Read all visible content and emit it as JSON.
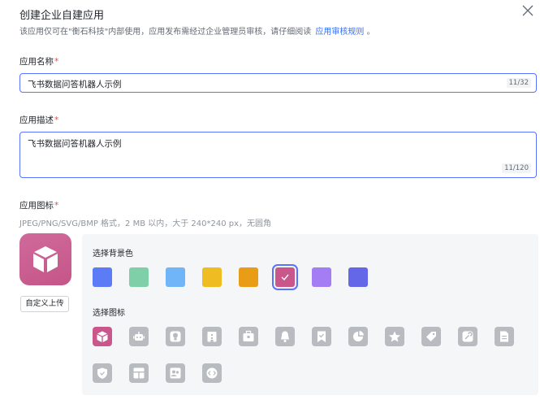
{
  "dialog": {
    "title": "创建企业自建应用",
    "subtitle": "该应用仅可在\"衡石科技\"内部使用，应用发布需经过企业管理员审核，请仔细阅读",
    "subtitle_link": "应用审核规则",
    "subtitle_end": "。"
  },
  "name_field": {
    "label": "应用名称",
    "required": "*",
    "value": "飞书数据问答机器人示例",
    "counter": "11/32"
  },
  "desc_field": {
    "label": "应用描述",
    "required": "*",
    "value": "飞书数据问答机器人示例",
    "counter": "11/120"
  },
  "icon_field": {
    "label": "应用图标",
    "required": "*",
    "hint": "JPEG/PNG/SVG/BMP 格式，2 MB 以内，大于 240*240 px，无圆角",
    "upload_label": "自定义上传",
    "bg_section_title": "选择背景色",
    "icon_section_title": "选择图标",
    "colors": [
      "#5b7cf6",
      "#7fcfa9",
      "#6fb5f7",
      "#efbd22",
      "#e99d17",
      "#c9578c",
      "#a47cf3",
      "#6367e8"
    ],
    "selected_color": "#c9578c",
    "icons": [
      "cube-icon",
      "robot-icon",
      "bulb-icon",
      "building-icon",
      "toolbox-icon",
      "bell-icon",
      "bookmark-check-icon",
      "pie-chart-icon",
      "star-icon",
      "tag-icon",
      "wrench-icon",
      "document-icon",
      "shield-check-icon",
      "layout-icon",
      "users-icon",
      "code-icon"
    ]
  }
}
